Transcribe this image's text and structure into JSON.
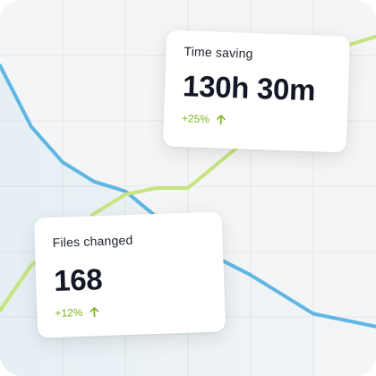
{
  "colors": {
    "background": "#f4f5f6",
    "gridline": "#e3e6e8",
    "blue_series": "#5fb6e4",
    "green_series": "#c6e47f",
    "positive": "#7cb518",
    "card_text": "#141824"
  },
  "cards": {
    "time_saving": {
      "label": "Time saving",
      "value": "130h 30m",
      "delta": "+25%",
      "trend_icon": "arrow-up-icon"
    },
    "files_changed": {
      "label": "Files changed",
      "value": "168",
      "delta": "+12%",
      "trend_icon": "arrow-up-icon"
    }
  },
  "chart_data": {
    "type": "line",
    "title": "",
    "xlabel": "",
    "ylabel": "",
    "grid": true,
    "x": [
      0,
      1,
      2,
      3,
      4,
      5,
      6,
      7,
      8,
      9,
      10,
      11,
      12
    ],
    "ylim": [
      0,
      100
    ],
    "series": [
      {
        "color": "#5fb6e4",
        "values": [
          88,
          69,
          58,
          52,
          49,
          41,
          35,
          28,
          23,
          17,
          11,
          9,
          7
        ]
      },
      {
        "color": "#c6e47f",
        "values": [
          12,
          26,
          33,
          42,
          48,
          50,
          50,
          58,
          66,
          75,
          86,
          94,
          97
        ]
      }
    ]
  }
}
